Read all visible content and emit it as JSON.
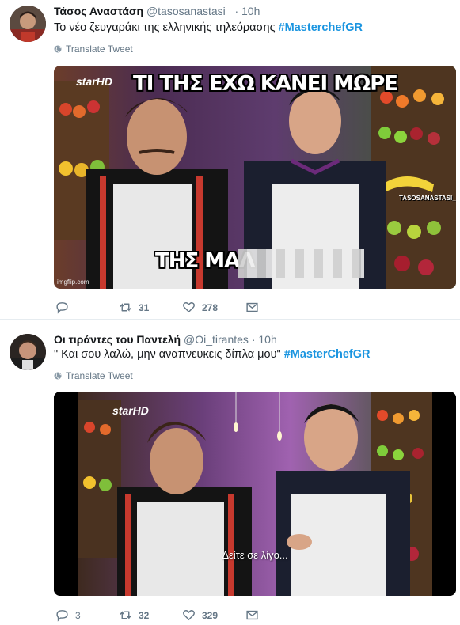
{
  "tweets": [
    {
      "name": "Τάσος Αναστάση",
      "handle": "@tasosanastasi_",
      "time": "10h",
      "text": "Το νέο ζευγαράκι της ελληνικής τηλεόρασης ",
      "hashtag": "#MasterchefGR",
      "translate": "Translate Tweet",
      "meme_top": "ΤΙ ΤΗΣ ΕΧΩ ΚΑΝΕΙ ΜΩΡΕ",
      "meme_bottom": "ΤΗΣ ΜΑΛ",
      "channel_logo": "starHD",
      "watermark": "TASOSANASTASI_",
      "imgflip": "imgflip.com",
      "reply_count": "",
      "retweet_count": "31",
      "like_count": "278"
    },
    {
      "name": "Οι τιράντες του Παντελή",
      "handle": "@Oi_tirantes",
      "time": "10h",
      "text": "\" Και σου λαλώ, μην αναπνευκεις δίπλα μου\" ",
      "hashtag": "#MasterChefGR",
      "translate": "Translate Tweet",
      "channel_logo": "starHD",
      "subtitle": "Δείτε σε λίγο...",
      "reply_count": "3",
      "retweet_count": "32",
      "like_count": "329"
    }
  ],
  "colors": {
    "link": "#1b95e0",
    "secondary": "#657786",
    "text": "#14171a",
    "separator": "#e6ecf0"
  },
  "icons": [
    "globe-icon",
    "reply-icon",
    "retweet-icon",
    "like-icon",
    "message-icon"
  ]
}
